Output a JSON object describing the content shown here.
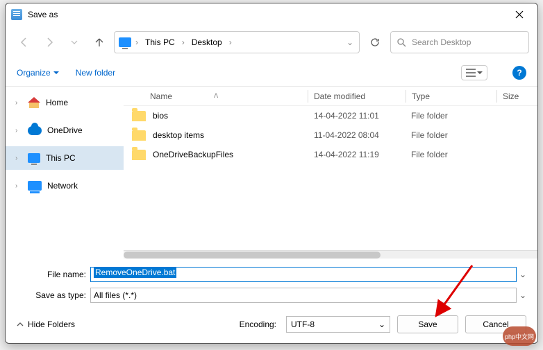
{
  "title": "Save as",
  "breadcrumb": {
    "seg1": "This PC",
    "seg2": "Desktop"
  },
  "search": {
    "placeholder": "Search Desktop"
  },
  "toolbar": {
    "organize": "Organize",
    "newfolder": "New folder"
  },
  "sidebar": {
    "items": [
      {
        "label": "Home"
      },
      {
        "label": "OneDrive"
      },
      {
        "label": "This PC"
      },
      {
        "label": "Network"
      }
    ]
  },
  "columns": {
    "name": "Name",
    "date": "Date modified",
    "type": "Type",
    "size": "Size"
  },
  "files": [
    {
      "name": "bios",
      "date": "14-04-2022 11:01",
      "type": "File folder"
    },
    {
      "name": "desktop items",
      "date": "11-04-2022 08:04",
      "type": "File folder"
    },
    {
      "name": "OneDriveBackupFiles",
      "date": "14-04-2022 11:19",
      "type": "File folder"
    }
  ],
  "form": {
    "filename_label": "File name:",
    "filename_value": "RemoveOneDrive.bat",
    "saveastype_label": "Save as type:",
    "saveastype_value": "All files  (*.*)"
  },
  "footer": {
    "hide_folders": "Hide Folders",
    "encoding_label": "Encoding:",
    "encoding_value": "UTF-8",
    "save": "Save",
    "cancel": "Cancel"
  },
  "watermark": "php中文网"
}
